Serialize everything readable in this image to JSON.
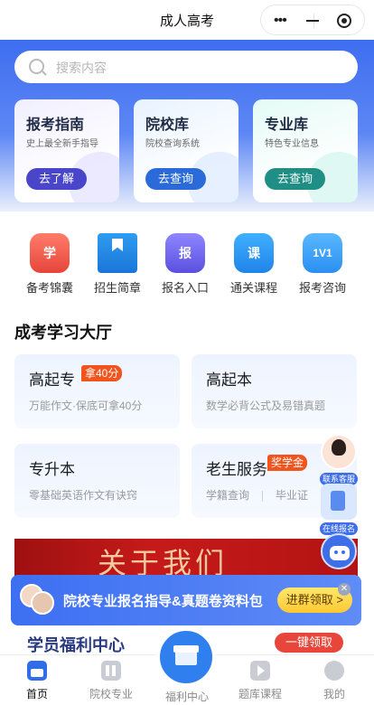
{
  "app": {
    "title": "成人高考"
  },
  "search": {
    "placeholder": "搜索内容"
  },
  "guide_cards": [
    {
      "title": "报考指南",
      "subtitle": "史上最全新手指导",
      "button": "去了解"
    },
    {
      "title": "院校库",
      "subtitle": "院校查询系统",
      "button": "去查询"
    },
    {
      "title": "专业库",
      "subtitle": "特色专业信息",
      "button": "去查询"
    }
  ],
  "quick_icons": [
    {
      "label": "备考锦囊",
      "glyph": "学",
      "icon": "study-bag-icon"
    },
    {
      "label": "招生简章",
      "glyph": "",
      "icon": "bookmark-book-icon"
    },
    {
      "label": "报名入口",
      "glyph": "报",
      "icon": "signup-bag-icon"
    },
    {
      "label": "通关课程",
      "glyph": "课",
      "icon": "course-bag-icon"
    },
    {
      "label": "报考咨询",
      "glyph": "1V1",
      "icon": "consult-1v1-icon"
    }
  ],
  "hall": {
    "title": "成考学习大厅",
    "tiles": [
      {
        "title": "高起专",
        "badge": "拿40分",
        "desc": "万能作文·保底可拿40分"
      },
      {
        "title": "高起本",
        "badge": "",
        "desc": "数学必背公式及易错真题"
      },
      {
        "title": "专升本",
        "badge": "",
        "desc": "零基础英语作文有诀窍"
      },
      {
        "title": "老生服务",
        "badge": "奖学金",
        "desc_left": "学籍查询",
        "desc_right": "毕业证"
      }
    ]
  },
  "banner": {
    "text": "关于我们"
  },
  "promo": {
    "text": "院校专业报名指导&真题卷资料包",
    "button": "进群领取 >",
    "close": "✕"
  },
  "peek": {
    "title": "学员福利中心",
    "button": "一键领取"
  },
  "floaters": [
    {
      "label": "联系客服",
      "icon": "customer-service-avatar-icon"
    },
    {
      "label": "在线报名",
      "icon": "online-signup-icon"
    },
    {
      "label": "AI客服",
      "icon": "robot-icon"
    }
  ],
  "tabbar": {
    "items": [
      {
        "label": "首页",
        "icon": "home-icon",
        "active": true
      },
      {
        "label": "院校专业",
        "icon": "school-library-icon",
        "active": false
      },
      {
        "label": "福利中心",
        "icon": "gift-icon",
        "active": false
      },
      {
        "label": "题库课程",
        "icon": "video-course-icon",
        "active": false
      },
      {
        "label": "我的",
        "icon": "profile-icon",
        "active": false
      }
    ]
  },
  "colors": {
    "primary": "#3e6ef0",
    "badge": "#f2541d",
    "banner": "#c61a1a"
  }
}
